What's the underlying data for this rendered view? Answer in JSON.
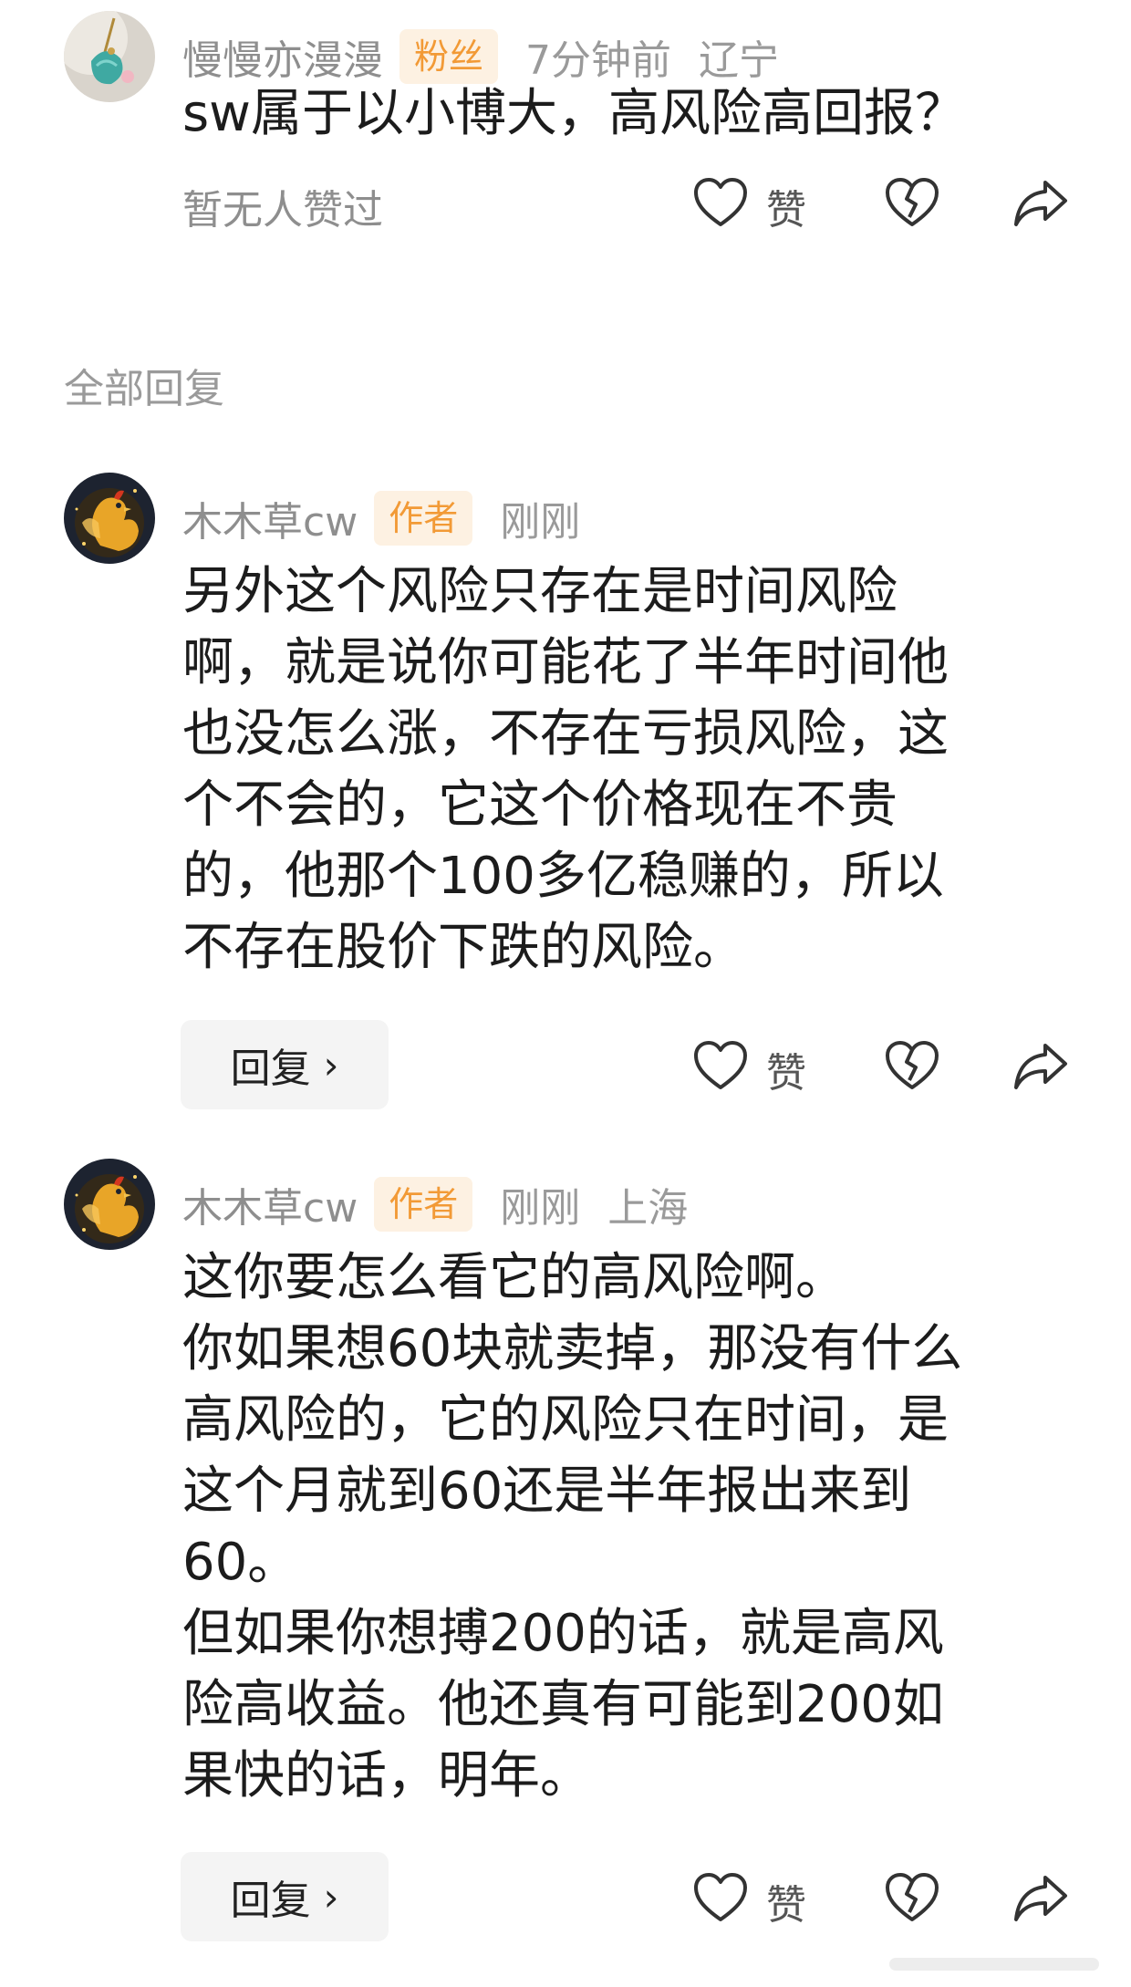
{
  "comments": [
    {
      "username": "慢慢亦漫漫",
      "badge": "粉丝",
      "time": "7分钟前",
      "location": "辽宁",
      "text": "sw属于以小博大，高风险高回报？",
      "no_likes": "暂无人赞过",
      "like_label": "赞",
      "avatar_icon": "tassel-charm-avatar"
    },
    {
      "username": "木木草cw",
      "badge": "作者",
      "time": "刚刚",
      "location": "",
      "text": "另外这个风险只存在是时间风险\n啊，就是说你可能花了半年时间他\n也没怎么涨，不存在亏损风险，这\n个不会的，它这个价格现在不贵\n的，他那个100多亿稳赚的，所以\n不存在股价下跌的风险。",
      "reply_label": "回复",
      "like_label": "赞",
      "avatar_icon": "golden-rooster-avatar"
    },
    {
      "username": "木木草cw",
      "badge": "作者",
      "time": "刚刚",
      "location": "上海",
      "text": "这你要怎么看它的高风险啊。\n你如果想60块就卖掉，那没有什么\n高风险的，它的风险只在时间，是\n这个月就到60还是半年报出来到\n60。\n但如果你想搏200的话，就是高风\n险高收益。他还真有可能到200如\n果快的话，明年。",
      "reply_label": "回复",
      "like_label": "赞",
      "avatar_icon": "golden-rooster-avatar"
    }
  ],
  "section_title": "全部回复",
  "colors": {
    "badge_bg": "#fdf1e2",
    "badge_text": "#f29a36",
    "meta_text": "#9a9a9a",
    "reply_bg": "#f4f4f4"
  }
}
